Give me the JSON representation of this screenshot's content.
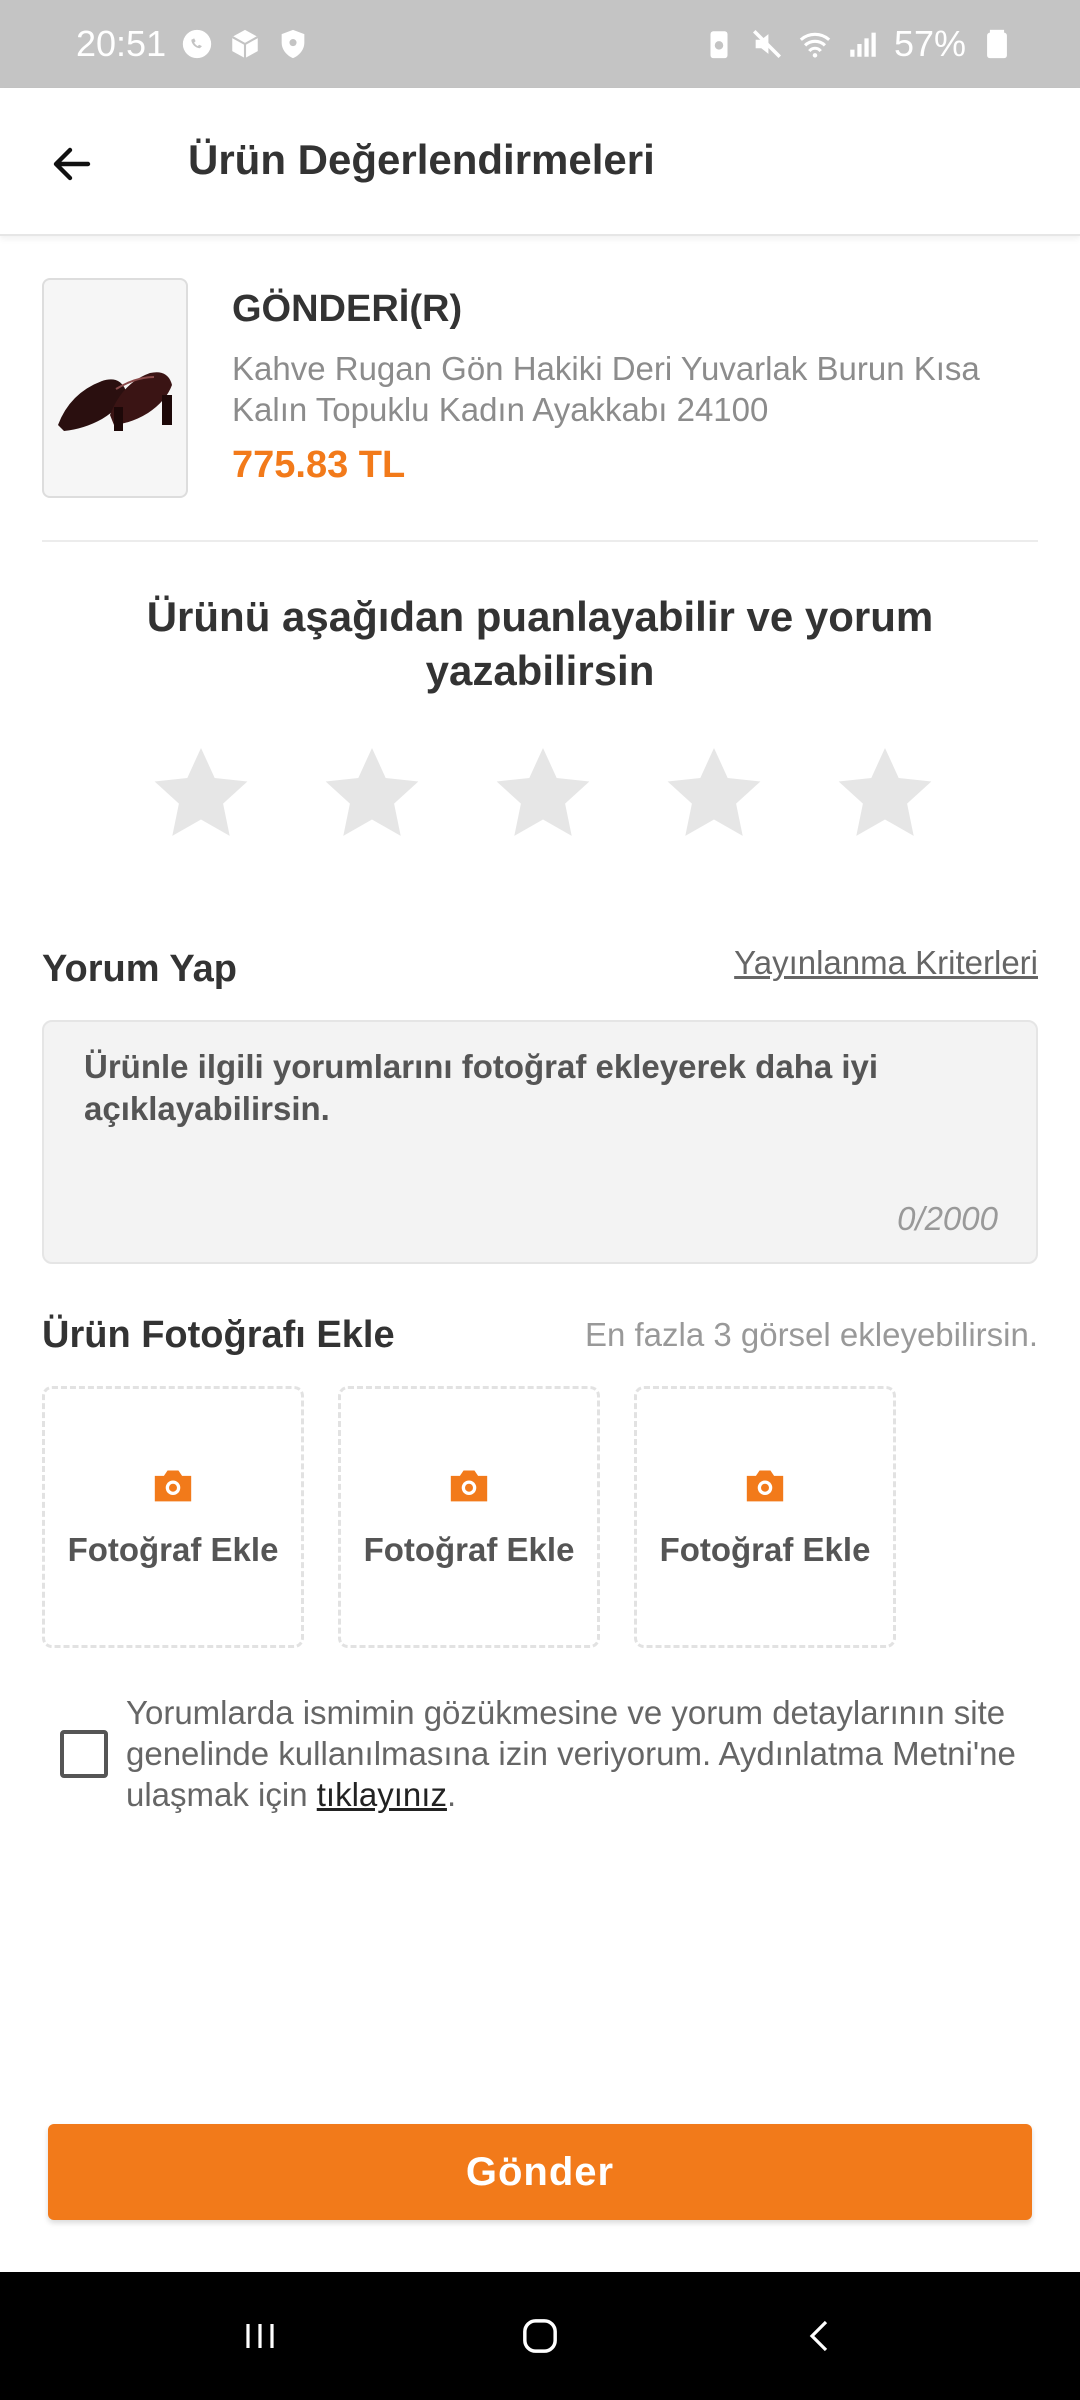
{
  "status_bar": {
    "time": "20:51",
    "battery": "57%",
    "left_icons": [
      "whatsapp-icon",
      "box-icon",
      "shield-icon"
    ],
    "right_icons": [
      "battery-saver-icon",
      "mute-icon",
      "wifi-icon",
      "signal-icon",
      "battery-icon"
    ]
  },
  "header": {
    "title": "Ürün Değerlendirmeleri",
    "back_icon": "arrow-left-icon"
  },
  "product": {
    "brand": "GÖNDERİ(R)",
    "name": "Kahve Rugan Gön Hakiki Deri Yuvarlak Burun Kısa Kalın Topuklu Kadın Ayakkabı 24100",
    "price": "775.83 TL"
  },
  "rating": {
    "prompt": "Ürünü aşağıdan puanlayabilir ve yorum yazabilirsin",
    "max_stars": 5,
    "selected": 0,
    "star_color": "#e6e6e6"
  },
  "comment": {
    "section_title": "Yorum Yap",
    "criteria_link": "Yayınlanma Kriterleri",
    "placeholder": "Ürünle ilgili yorumlarını fotoğraf ekleyerek daha iyi açıklayabilirsin.",
    "counter": "0/2000"
  },
  "photos": {
    "section_title": "Ürün Fotoğrafı Ekle",
    "hint": "En fazla 3 görsel ekleyebilirsin.",
    "slots": [
      {
        "label": "Fotoğraf Ekle"
      },
      {
        "label": "Fotoğraf Ekle"
      },
      {
        "label": "Fotoğraf Ekle"
      }
    ]
  },
  "consent": {
    "checked": false,
    "text": "Yorumlarda ismimin gözükmesine ve yorum detaylarının site genelinde kullanılmasına izin veriyorum. Aydınlatma Metni'ne ulaşmak için ",
    "link_text": "tıklayınız",
    "suffix": "."
  },
  "submit": {
    "label": "Gönder"
  },
  "colors": {
    "accent": "#f27a1a",
    "status_bar": "#c4c4c4"
  }
}
